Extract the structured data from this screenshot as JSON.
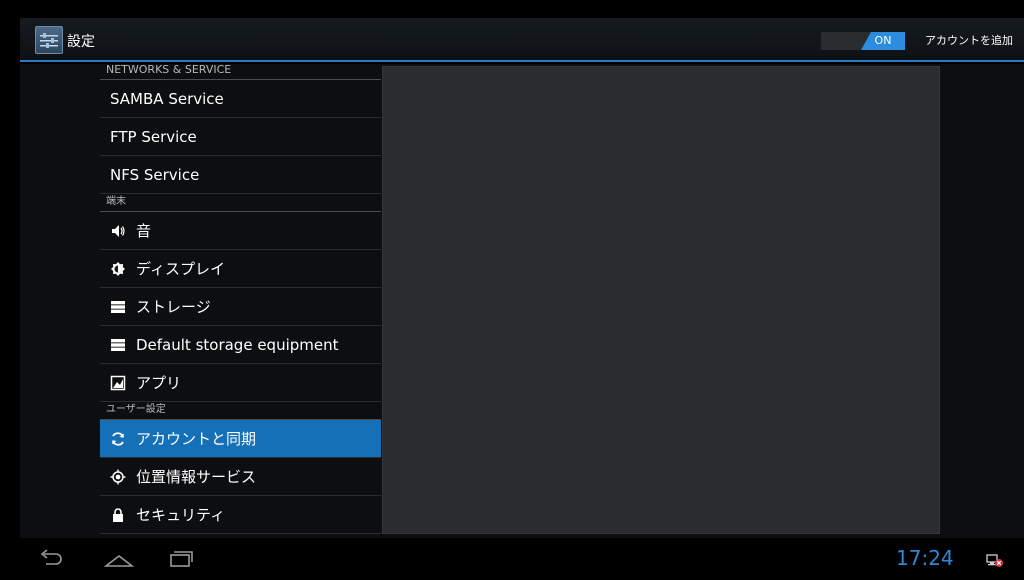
{
  "action_bar": {
    "title": "設定",
    "toggle_label": "ON",
    "add_account": "アカウントを追加"
  },
  "list": {
    "sections": [
      {
        "header": "NETWORKS & SERVICE",
        "items": [
          {
            "label": "SAMBA Service",
            "icon": ""
          },
          {
            "label": "FTP Service",
            "icon": ""
          },
          {
            "label": "NFS Service",
            "icon": ""
          }
        ]
      },
      {
        "header": "端末",
        "items": [
          {
            "label": "音",
            "icon": "speaker-icon"
          },
          {
            "label": "ディスプレイ",
            "icon": "brightness-icon"
          },
          {
            "label": "ストレージ",
            "icon": "storage-icon"
          },
          {
            "label": "Default storage equipment",
            "icon": "storage-icon"
          },
          {
            "label": "アプリ",
            "icon": "apps-icon"
          }
        ]
      },
      {
        "header": "ユーザー設定",
        "items": [
          {
            "label": "アカウントと同期",
            "icon": "sync-icon",
            "selected": true
          },
          {
            "label": "位置情報サービス",
            "icon": "location-icon"
          },
          {
            "label": "セキュリティ",
            "icon": "lock-icon"
          }
        ]
      }
    ]
  },
  "status_bar": {
    "clock": "17:24"
  },
  "colors": {
    "accent": "#2c8ce0",
    "selected": "#1670b8",
    "clock": "#2e88d6"
  }
}
